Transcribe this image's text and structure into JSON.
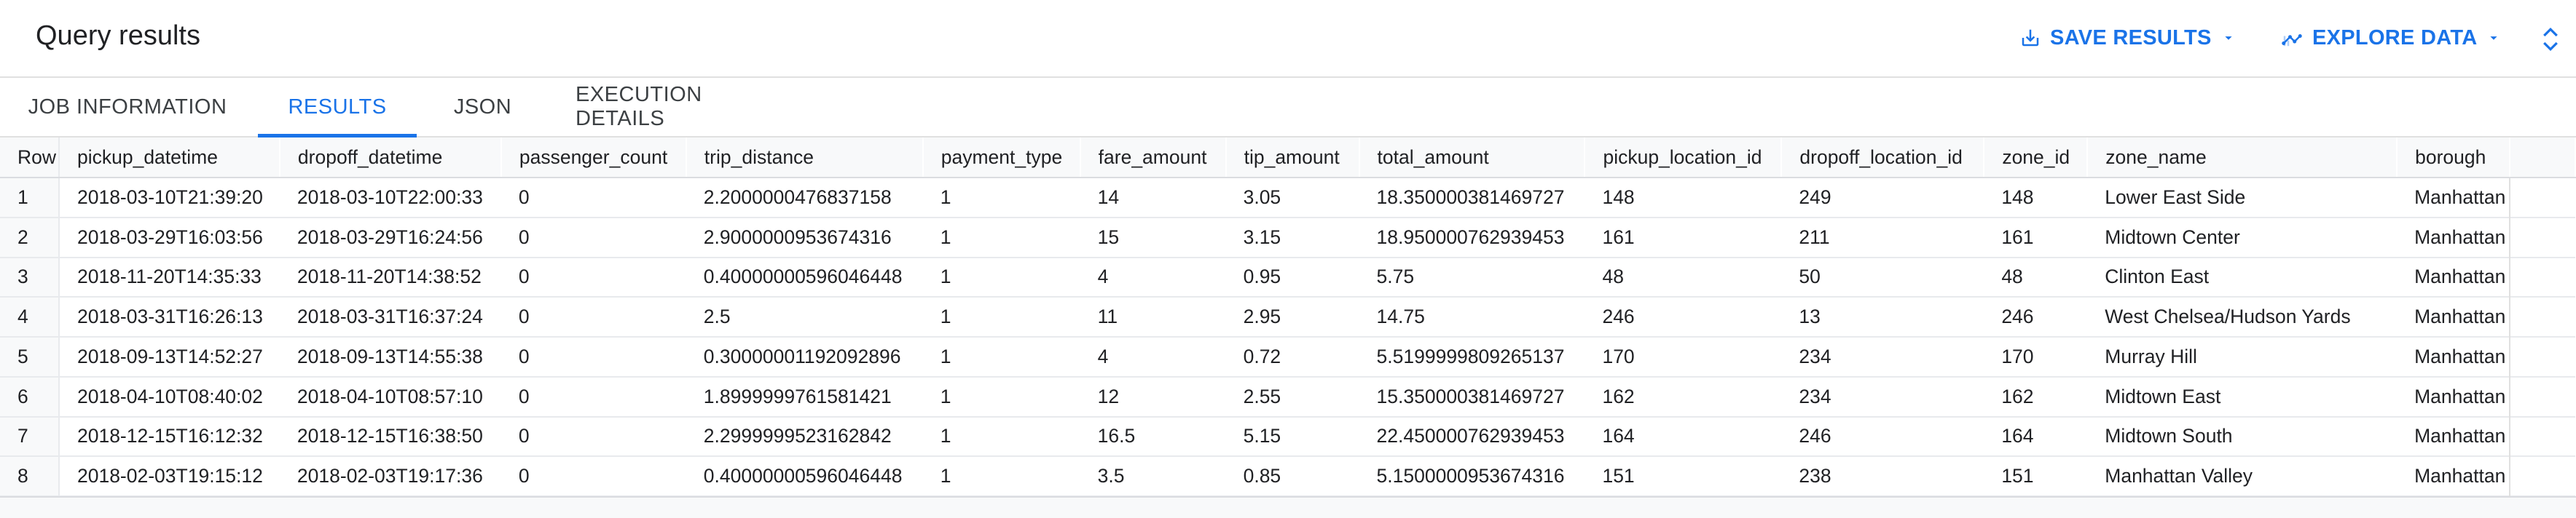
{
  "header": {
    "title": "Query results",
    "save_results_label": "SAVE RESULTS",
    "explore_data_label": "EXPLORE DATA",
    "accent_color": "#1a73e8"
  },
  "tabs": [
    {
      "label": "JOB INFORMATION",
      "active": false
    },
    {
      "label": "RESULTS",
      "active": true
    },
    {
      "label": "JSON",
      "active": false
    },
    {
      "label": "EXECUTION DETAILS",
      "active": false
    }
  ],
  "table": {
    "columns": [
      "Row",
      "pickup_datetime",
      "dropoff_datetime",
      "passenger_count",
      "trip_distance",
      "payment_type",
      "fare_amount",
      "tip_amount",
      "total_amount",
      "pickup_location_id",
      "dropoff_location_id",
      "zone_id",
      "zone_name",
      "borough"
    ],
    "rows": [
      [
        "1",
        "2018-03-10T21:39:20",
        "2018-03-10T22:00:33",
        "0",
        "2.2000000476837158",
        "1",
        "14",
        "3.05",
        "18.350000381469727",
        "148",
        "249",
        "148",
        "Lower East Side",
        "Manhattan"
      ],
      [
        "2",
        "2018-03-29T16:03:56",
        "2018-03-29T16:24:56",
        "0",
        "2.9000000953674316",
        "1",
        "15",
        "3.15",
        "18.950000762939453",
        "161",
        "211",
        "161",
        "Midtown Center",
        "Manhattan"
      ],
      [
        "3",
        "2018-11-20T14:35:33",
        "2018-11-20T14:38:52",
        "0",
        "0.40000000596046448",
        "1",
        "4",
        "0.95",
        "5.75",
        "48",
        "50",
        "48",
        "Clinton East",
        "Manhattan"
      ],
      [
        "4",
        "2018-03-31T16:26:13",
        "2018-03-31T16:37:24",
        "0",
        "2.5",
        "1",
        "11",
        "2.95",
        "14.75",
        "246",
        "13",
        "246",
        "West Chelsea/Hudson Yards",
        "Manhattan"
      ],
      [
        "5",
        "2018-09-13T14:52:27",
        "2018-09-13T14:55:38",
        "0",
        "0.30000001192092896",
        "1",
        "4",
        "0.72",
        "5.5199999809265137",
        "170",
        "234",
        "170",
        "Murray Hill",
        "Manhattan"
      ],
      [
        "6",
        "2018-04-10T08:40:02",
        "2018-04-10T08:57:10",
        "0",
        "1.8999999761581421",
        "1",
        "12",
        "2.55",
        "15.350000381469727",
        "162",
        "234",
        "162",
        "Midtown East",
        "Manhattan"
      ],
      [
        "7",
        "2018-12-15T16:12:32",
        "2018-12-15T16:38:50",
        "0",
        "2.2999999523162842",
        "1",
        "16.5",
        "5.15",
        "22.450000762939453",
        "164",
        "246",
        "164",
        "Midtown South",
        "Manhattan"
      ],
      [
        "8",
        "2018-02-03T19:15:12",
        "2018-02-03T19:17:36",
        "0",
        "0.40000000596046448",
        "1",
        "3.5",
        "0.85",
        "5.1500000953674316",
        "151",
        "238",
        "151",
        "Manhattan Valley",
        "Manhattan"
      ]
    ]
  }
}
